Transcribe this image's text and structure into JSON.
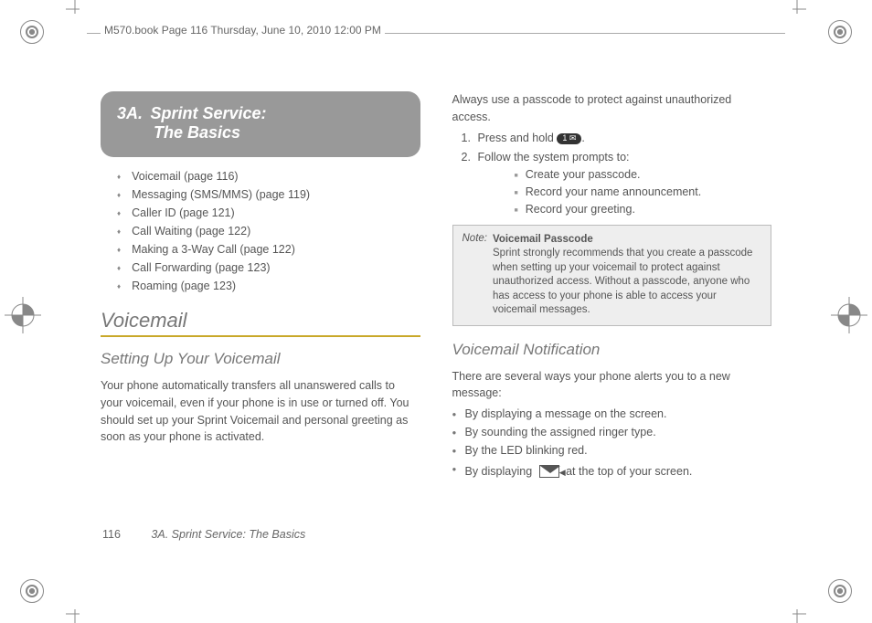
{
  "header": "M570.book  Page 116  Thursday, June 10, 2010  12:00 PM",
  "section": {
    "num": "3A.",
    "title1": "Sprint Service:",
    "title2": "The Basics"
  },
  "toc": [
    "Voicemail (page 116)",
    "Messaging (SMS/MMS) (page 119)",
    "Caller ID (page 121)",
    "Call Waiting (page 122)",
    "Making a 3-Way Call (page 122)",
    "Call Forwarding (page 123)",
    "Roaming (page 123)"
  ],
  "h_voicemail": "Voicemail",
  "h_setup": "Setting Up Your Voicemail",
  "p_setup": "Your phone automatically transfers all unanswered calls to your voicemail, even if your phone is in use or turned off. You should set up your Sprint Voicemail and personal greeting as soon as your phone is activated.",
  "p_passcode": "Always use a passcode to protect against unauthorized access.",
  "step1_a": "Press and hold ",
  "step1_b": ".",
  "key1": "1 ✉",
  "step2": "Follow the system prompts to:",
  "sub1": "Create your passcode.",
  "sub2": "Record your name announcement.",
  "sub3": "Record your greeting.",
  "note_label": "Note:",
  "note_title": "Voicemail Passcode",
  "note_body": "Sprint strongly recommends that you create a passcode when setting up your voicemail to protect against unauthorized access. Without a passcode, anyone who has access to your phone is able to access your voicemail messages.",
  "h_notify": "Voicemail Notification",
  "p_notify": "There are several ways your phone alerts you to a new message:",
  "b1": "By displaying a message on the screen.",
  "b2": "By sounding the assigned ringer type.",
  "b3": "By the LED blinking red.",
  "b4a": "By displaying ",
  "b4b": " at the top of your screen.",
  "footer_page": "116",
  "footer_title": "3A. Sprint Service: The Basics"
}
